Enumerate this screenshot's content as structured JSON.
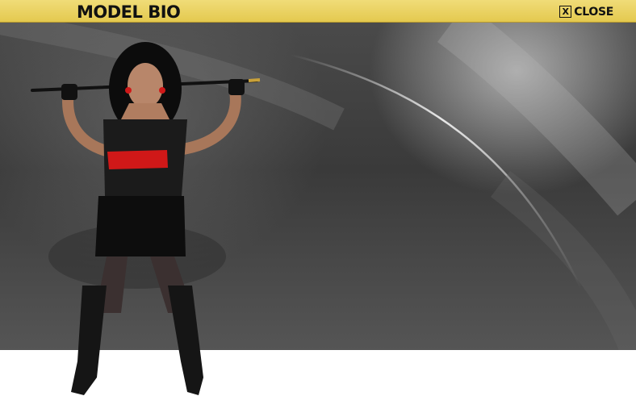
{
  "header": {
    "title": "MODEL BIO",
    "close_glyph": "X",
    "close_label": "CLOSE"
  },
  "colors": {
    "header_bg": "#e8cf5a",
    "backdrop": "#454545",
    "accent_red": "#d01818"
  },
  "icons": {
    "close": "close-icon"
  }
}
